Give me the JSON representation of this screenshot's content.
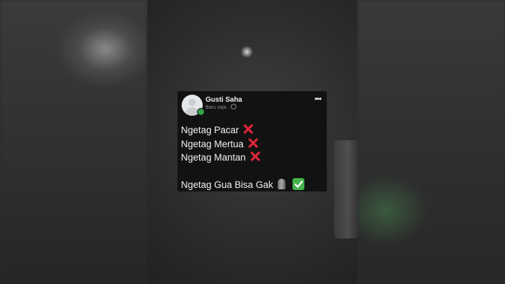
{
  "post": {
    "author": "Gusti Saha",
    "time": "Baru saja",
    "menu_glyph": "•••",
    "lines": [
      "Ngetag Pacar",
      "Ngetag Mertua",
      "Ngetag Mantan",
      "Ngetag Gua Bisa Gak"
    ],
    "line_marks": [
      "cross-mark",
      "cross-mark",
      "cross-mark",
      "moai-icon check-mark"
    ],
    "colors": {
      "card_bg": "#121212",
      "online": "#31a24c",
      "cross": "#e0263a",
      "check": "#44b24a"
    }
  }
}
